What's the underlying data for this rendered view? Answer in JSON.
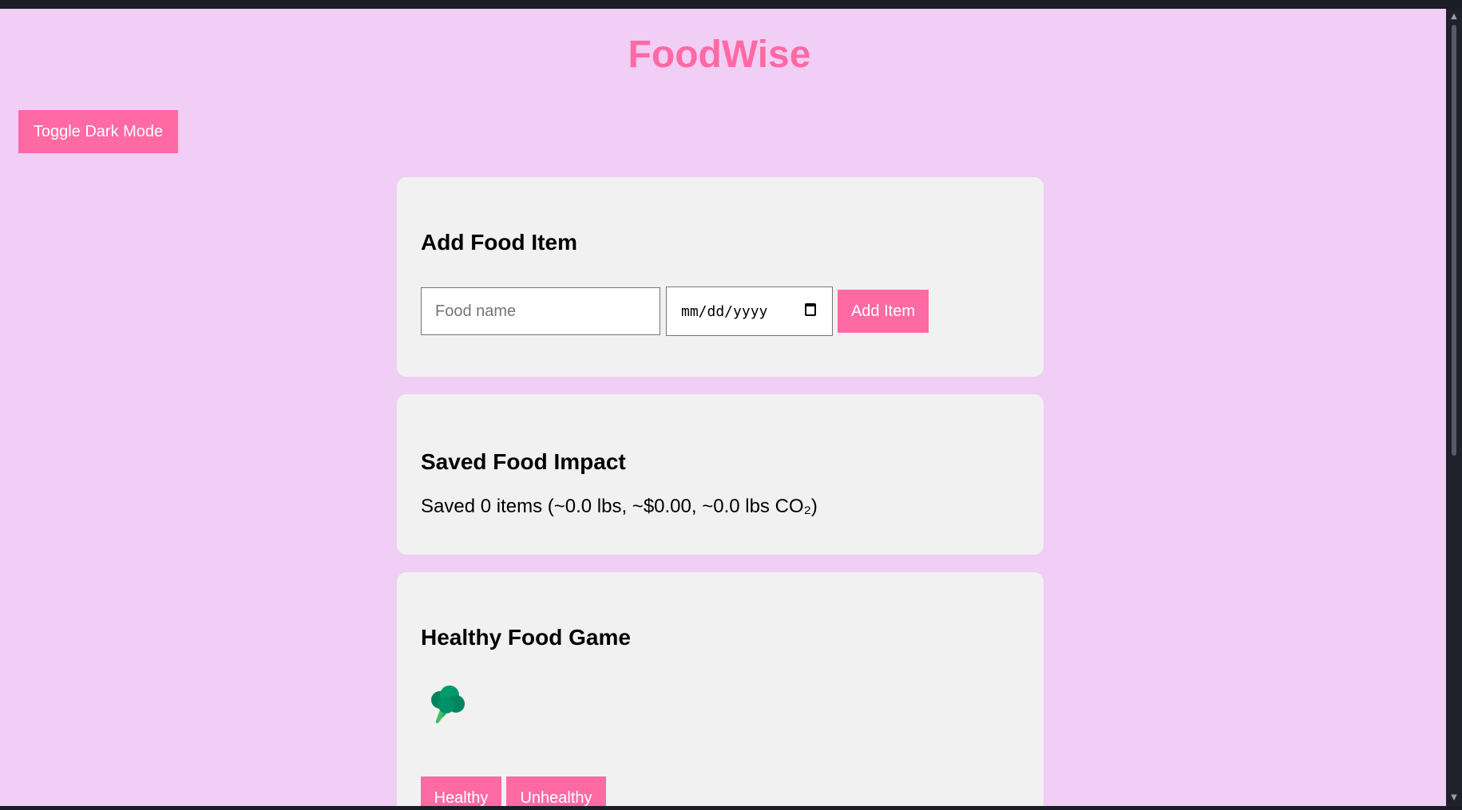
{
  "header": {
    "title": "FoodWise",
    "toggle_label": "Toggle Dark Mode"
  },
  "add_food": {
    "heading": "Add Food Item",
    "name_placeholder": "Food name",
    "name_value": "",
    "date_placeholder": "mm/dd/yyyy",
    "button_label": "Add Item"
  },
  "impact": {
    "heading": "Saved Food Impact",
    "summary": "Saved 0 items (~0.0 lbs, ~$0.00, ~0.0 lbs CO₂)"
  },
  "game": {
    "heading": "Healthy Food Game",
    "current_food_icon": "broccoli-icon",
    "healthy_label": "Healthy",
    "unhealthy_label": "Unhealthy"
  },
  "colors": {
    "page_background": "#f0cef5",
    "accent": "#ff69a4",
    "card_background": "#f1f1f1"
  }
}
